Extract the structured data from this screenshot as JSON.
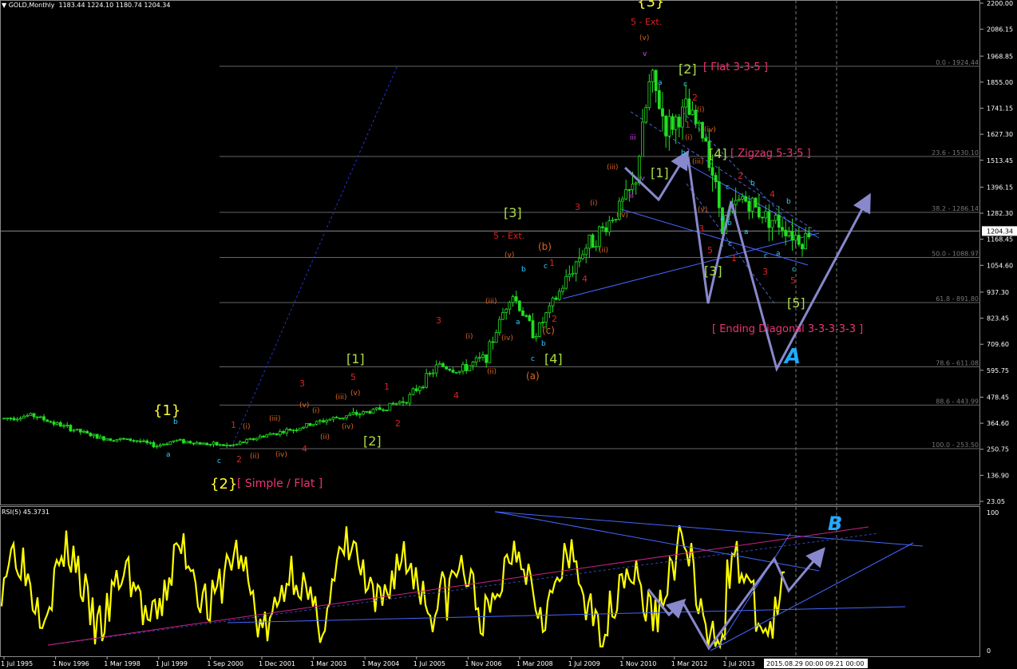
{
  "header": {
    "symbol": "GOLD,Monthly",
    "ohlc": [
      "1183.44",
      "1224.10",
      "1180.74",
      "1204.34"
    ]
  },
  "rsi_header": "RSI(5) 45.3731",
  "current_price": "1204.34",
  "colors": {
    "candle": "#22dd22",
    "rsi": "#ffff00",
    "wave_yellow": "#ffff33",
    "wave_green": "#aadd44",
    "wave_red": "#dd2222",
    "wave_orange": "#dd6622",
    "wave_cyan": "#33ccff",
    "wave_magenta": "#dd44ff",
    "pink_label": "#ee3377",
    "fib_line": "#666666",
    "trendline": "#4466ff",
    "arrow": "#8888cc",
    "letter_cyan": "#22aaff"
  },
  "chart_data": [
    {
      "type": "candlestick",
      "title": "GOLD,Monthly",
      "y_axis_ticks": [
        "2200.00",
        "2086.15",
        "1968.85",
        "1855.00",
        "1741.15",
        "1627.30",
        "1513.45",
        "1396.15",
        "1282.30",
        "1168.45",
        "1054.60",
        "937.30",
        "823.45",
        "709.60",
        "595.75",
        "478.45",
        "364.60",
        "250.75",
        "136.90",
        "23.05"
      ],
      "x_axis_ticks": [
        "1 Jul 1995",
        "1 Nov 1996",
        "1 Mar 1998",
        "1 Jul 1999",
        "1 Sep 2000",
        "1 Dec 2001",
        "1 Mar 2003",
        "1 May 2004",
        "1 Jul 2005",
        "1 Nov 2006",
        "1 Mar 2008",
        "1 Jul 2009",
        "1 Nov 2010",
        "1 Mar 2012",
        "1 Jul 2013"
      ],
      "x_axis_highlight": "2015.08.29 00:00 09.21 00:00",
      "ylim": [
        23.05,
        2200
      ],
      "price_path": [
        [
          1995.5,
          385
        ],
        [
          1996.2,
          400
        ],
        [
          1997.0,
          350
        ],
        [
          1997.9,
          300
        ],
        [
          1998.8,
          290
        ],
        [
          1999.3,
          265
        ],
        [
          1999.8,
          290
        ],
        [
          2000.5,
          275
        ],
        [
          2001.2,
          265
        ],
        [
          2002.0,
          310
        ],
        [
          2002.8,
          340
        ],
        [
          2003.6,
          380
        ],
        [
          2004.5,
          410
        ],
        [
          2005.0,
          430
        ],
        [
          2005.6,
          470
        ],
        [
          2006.4,
          620
        ],
        [
          2006.9,
          590
        ],
        [
          2007.6,
          660
        ],
        [
          2008.2,
          940
        ],
        [
          2008.8,
          750
        ],
        [
          2009.4,
          930
        ],
        [
          2010.0,
          1120
        ],
        [
          2010.6,
          1230
        ],
        [
          2011.3,
          1400
        ],
        [
          2011.7,
          1880
        ],
        [
          2012.1,
          1650
        ],
        [
          2012.6,
          1730
        ],
        [
          2013.1,
          1600
        ],
        [
          2013.5,
          1240
        ],
        [
          2014.0,
          1350
        ],
        [
          2014.5,
          1280
        ],
        [
          2015.0,
          1230
        ],
        [
          2015.5,
          1160
        ],
        [
          2015.7,
          1204
        ]
      ],
      "fibonacci_levels": [
        {
          "label": "0.0 - 1924.44",
          "value": 1924.44
        },
        {
          "label": "23.6 - 1530.10",
          "value": 1530.1
        },
        {
          "label": "38.2 - 1286.14",
          "value": 1286.14
        },
        {
          "label": "50.0 - 1088.97",
          "value": 1088.97
        },
        {
          "label": "61.8 - 891.80",
          "value": 891.8
        },
        {
          "label": "78.6 - 611.08",
          "value": 611.08
        },
        {
          "label": "88.6 - 443.99",
          "value": 443.99
        },
        {
          "label": "100.0 - 253.50",
          "value": 253.5
        }
      ],
      "annotations": [
        {
          "text": "{1}",
          "color": "wave_yellow"
        },
        {
          "text": "{2}",
          "color": "wave_yellow"
        },
        {
          "text": "[ Simple / Flat ]",
          "color": "pink_label"
        },
        {
          "text": "{3}",
          "color": "wave_yellow"
        },
        {
          "text": "[1]",
          "color": "wave_green"
        },
        {
          "text": "[2]",
          "color": "wave_green"
        },
        {
          "text": "[3]",
          "color": "wave_green"
        },
        {
          "text": "[4]",
          "color": "wave_green"
        },
        {
          "text": "[5]",
          "color": "wave_green"
        },
        {
          "text": "[ Flat 3-3-5 ]",
          "color": "pink_label"
        },
        {
          "text": "[ Zigzag 5-3-5 ]",
          "color": "pink_label"
        },
        {
          "text": "[ Ending Diagonal 3-3-3-3-3 ]",
          "color": "pink_label"
        },
        {
          "text": "5 - Ext.",
          "color": "wave_red"
        },
        {
          "text": "5 - Ext.",
          "color": "wave_red"
        },
        {
          "text": "(a)",
          "color": "wave_orange"
        },
        {
          "text": "(b)",
          "color": "wave_orange"
        },
        {
          "text": "(c)",
          "color": "wave_orange"
        },
        {
          "text": "A",
          "color": "letter_cyan"
        }
      ]
    },
    {
      "type": "line",
      "title": "RSI(5) 45.3731",
      "ylim": [
        0,
        100
      ],
      "y_axis_ticks": [
        "100",
        "0"
      ],
      "annotations": [
        {
          "text": "B",
          "color": "letter_cyan"
        }
      ]
    }
  ]
}
